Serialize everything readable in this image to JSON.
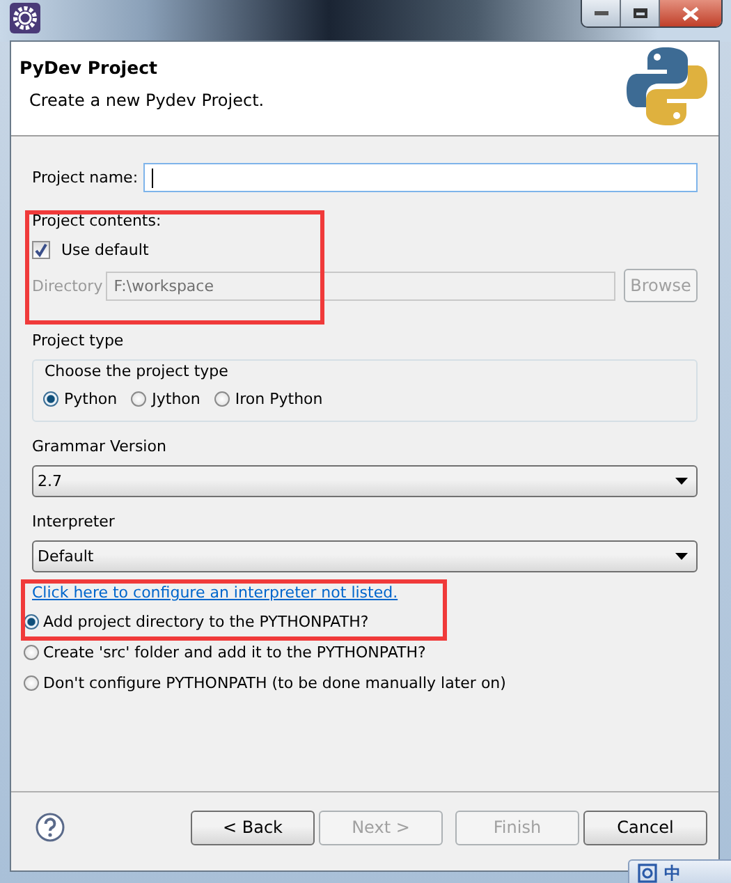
{
  "banner": {
    "title": "PyDev Project",
    "subtitle": "Create a new Pydev Project."
  },
  "project_name": {
    "label": "Project name:"
  },
  "project_contents": {
    "label": "Project contents:",
    "highlighted": true,
    "use_default": {
      "label": "Use default",
      "checked": true
    },
    "directory": {
      "label": "Directory",
      "value": "F:\\workspace",
      "disabled": true
    },
    "browse": {
      "label": "Browse",
      "disabled": true
    }
  },
  "project_type": {
    "label": "Project type",
    "group_label": "Choose the project type",
    "options": [
      {
        "label": "Python",
        "selected": true
      },
      {
        "label": "Jython",
        "selected": false
      },
      {
        "label": "Iron Python",
        "selected": false
      }
    ]
  },
  "grammar": {
    "label": "Grammar Version",
    "value": "2.7"
  },
  "interpreter": {
    "label": "Interpreter",
    "value": "Default"
  },
  "link": {
    "text": "Click here to configure an interpreter not listed.",
    "highlighted": true
  },
  "pythonpath": [
    {
      "label": "Add project directory to the PYTHONPATH?",
      "selected": true
    },
    {
      "label": "Create 'src' folder and add it to the PYTHONPATH?",
      "selected": false
    },
    {
      "label": "Don't configure PYTHONPATH (to be done manually later on)",
      "selected": false
    }
  ],
  "buttons": [
    {
      "label": "< Back",
      "disabled": false
    },
    {
      "label": "Next >",
      "disabled": true
    },
    {
      "label": "Finish",
      "disabled": true
    },
    {
      "label": "Cancel",
      "disabled": false
    }
  ],
  "ime_bar": {
    "label": "中"
  }
}
